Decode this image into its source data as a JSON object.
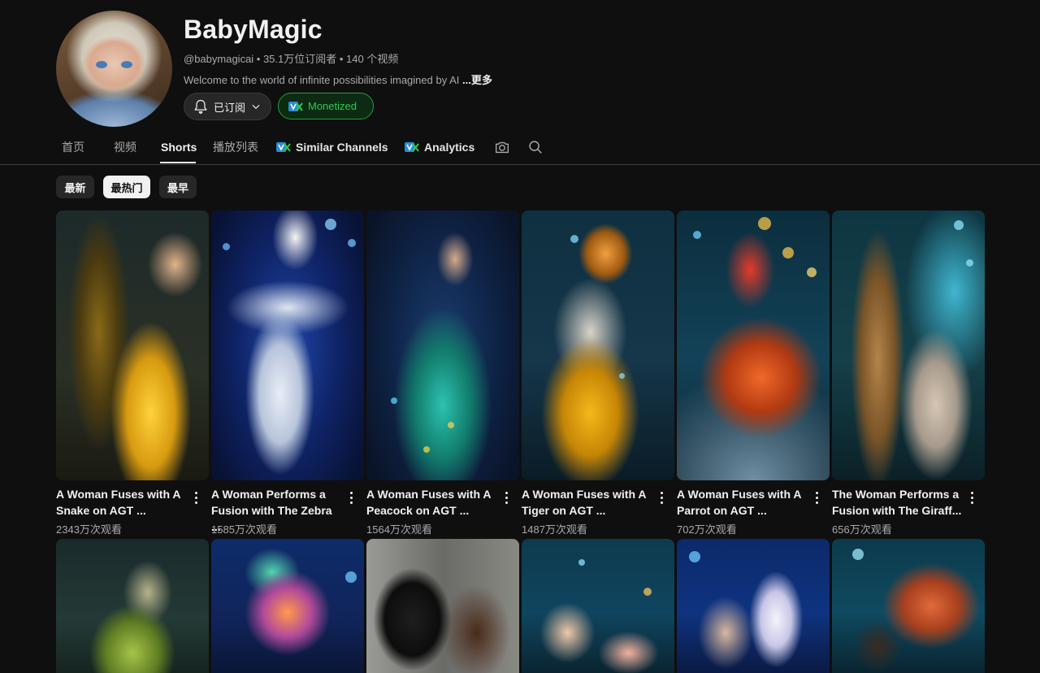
{
  "channel": {
    "name": "BabyMagic",
    "handle_stats": "@babymagicai • 35.1万位订阅者 • 140 个视频",
    "description": "Welcome to the world of infinite possibilities imagined by AI ",
    "more_label": "...更多",
    "subscribed_label": "已订阅",
    "monetized_label": "Monetized"
  },
  "tabs": {
    "home": "首页",
    "videos": "视频",
    "shorts": "Shorts",
    "playlists": "播放列表",
    "similar": "Similar Channels",
    "analytics": "Analytics"
  },
  "chips": [
    "最新",
    "最热门",
    "最早"
  ],
  "shorts_row1": [
    {
      "title_line1": "A Woman Fuses with A",
      "title_line2": "Snake on AGT ...",
      "views": "2343万次观看"
    },
    {
      "title_line1": "A Woman Performs a",
      "title_line2": "Fusion with The Zebra ...",
      "views": "1585万次观看"
    },
    {
      "title_line1": "A Woman Fuses with A",
      "title_line2": "Peacock on AGT ...",
      "views": "1564万次观看"
    },
    {
      "title_line1": "A Woman Fuses with A",
      "title_line2": "Tiger on AGT ...",
      "views": "1487万次观看"
    },
    {
      "title_line1": "A Woman Fuses with A",
      "title_line2": "Parrot on AGT ...",
      "views": "702万次观看"
    },
    {
      "title_line1": "The Woman Performs a",
      "title_line2": "Fusion with The Giraff...",
      "views": "656万次观看"
    }
  ],
  "colors": {
    "background": "#0f0f0f",
    "monetized_border": "#1ea23e",
    "monetized_text": "#2ec94f",
    "chip_active": "#f1f1f1"
  }
}
